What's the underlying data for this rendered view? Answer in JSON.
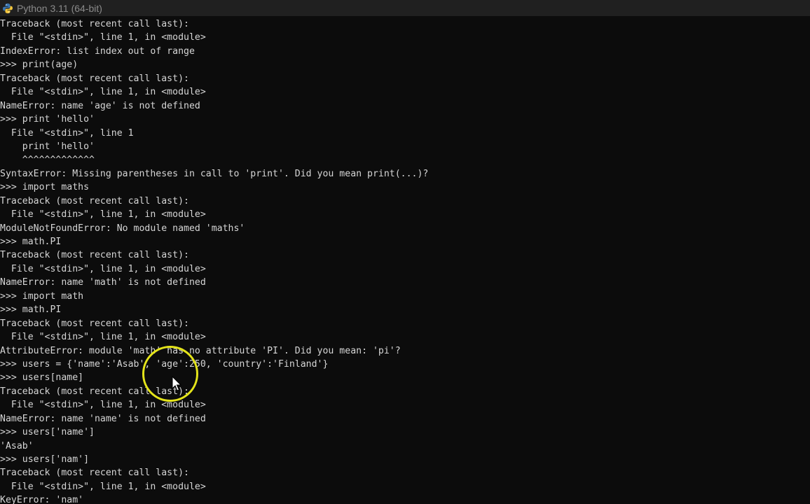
{
  "window": {
    "title": "Python 3.11 (64-bit)",
    "icon": "python-icon"
  },
  "console": {
    "lines": [
      "Traceback (most recent call last):",
      "  File \"<stdin>\", line 1, in <module>",
      "IndexError: list index out of range",
      ">>> print(age)",
      "Traceback (most recent call last):",
      "  File \"<stdin>\", line 1, in <module>",
      "NameError: name 'age' is not defined",
      ">>> print 'hello'",
      "  File \"<stdin>\", line 1",
      "    print 'hello'",
      "    ^^^^^^^^^^^^^",
      "SyntaxError: Missing parentheses in call to 'print'. Did you mean print(...)?",
      ">>> import maths",
      "Traceback (most recent call last):",
      "  File \"<stdin>\", line 1, in <module>",
      "ModuleNotFoundError: No module named 'maths'",
      ">>> math.PI",
      "Traceback (most recent call last):",
      "  File \"<stdin>\", line 1, in <module>",
      "NameError: name 'math' is not defined",
      ">>> import math",
      ">>> math.PI",
      "Traceback (most recent call last):",
      "  File \"<stdin>\", line 1, in <module>",
      "AttributeError: module 'math' has no attribute 'PI'. Did you mean: 'pi'?",
      ">>> users = {'name':'Asab', 'age':250, 'country':'Finland'}",
      ">>> users[name]",
      "Traceback (most recent call last):",
      "  File \"<stdin>\", line 1, in <module>",
      "NameError: name 'name' is not defined",
      ">>> users['name']",
      "'Asab'",
      ">>> users['nam']",
      "Traceback (most recent call last):",
      "  File \"<stdin>\", line 1, in <module>",
      "KeyError: 'nam'"
    ]
  },
  "colors": {
    "background": "#0c0c0c",
    "text": "#d6d6d6",
    "titlebar": "#202020",
    "cursor_ring": "#e4e41a"
  }
}
